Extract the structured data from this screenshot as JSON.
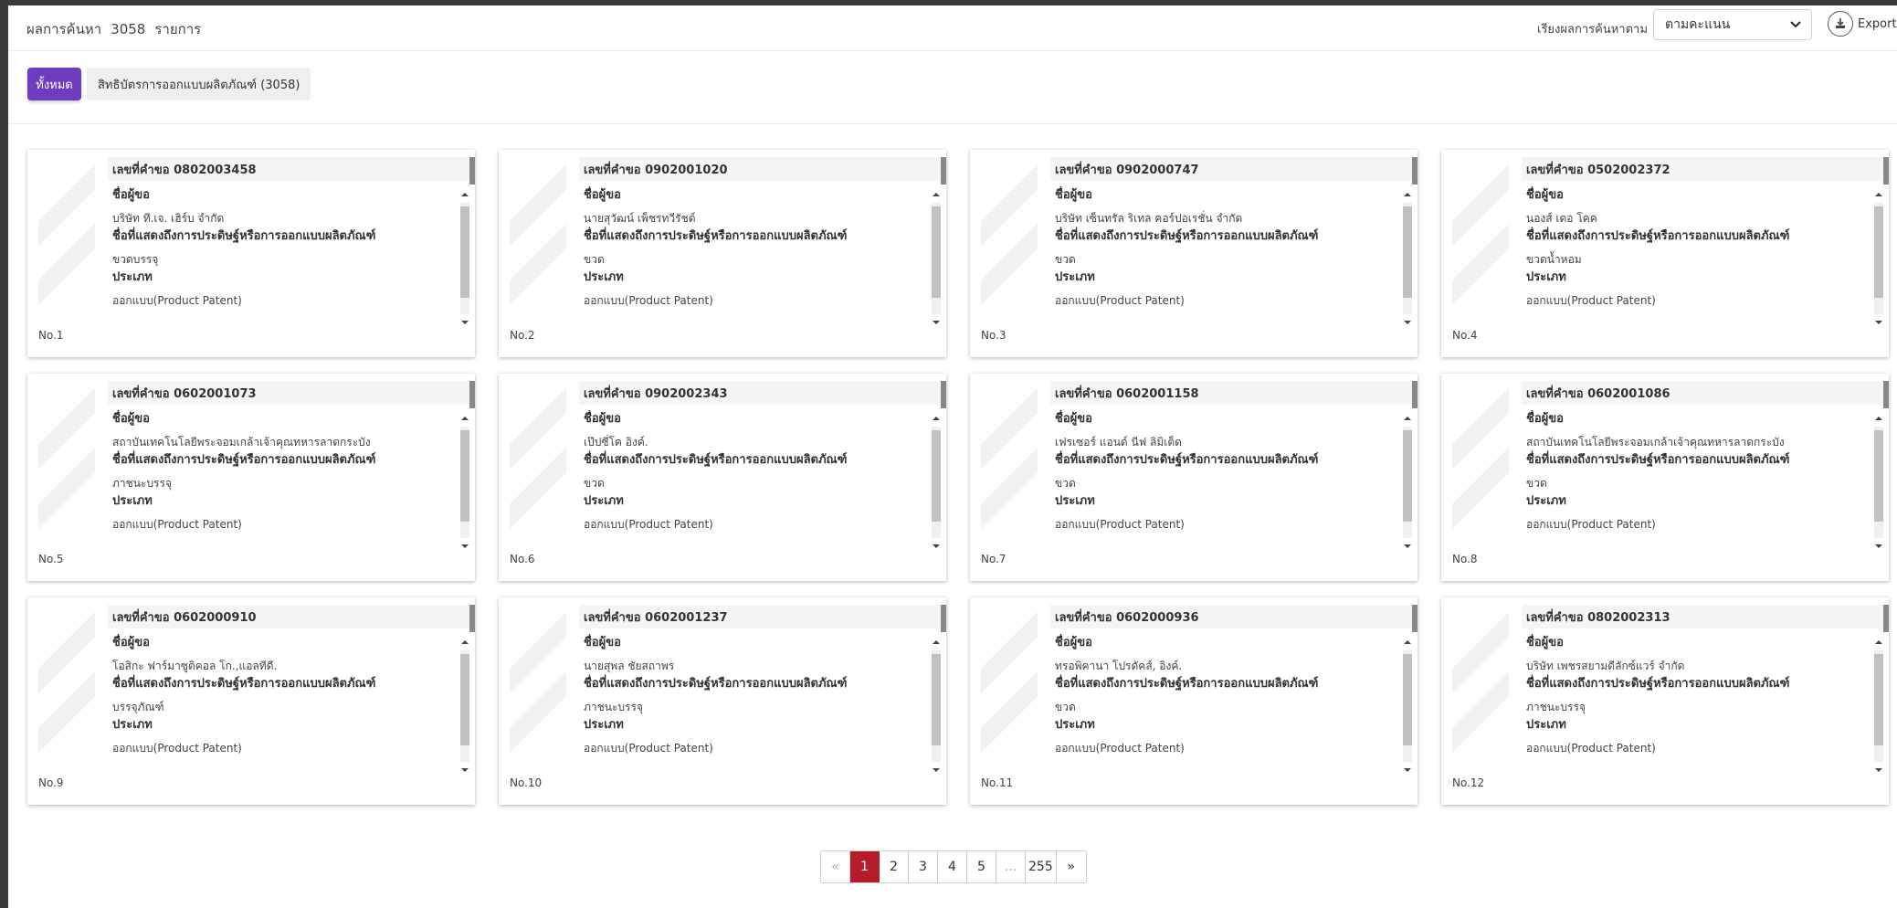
{
  "header": {
    "result_prefix": "ผลการค้นหา",
    "result_count": "3058",
    "result_suffix": "รายการ",
    "sort_label": "เรียงผลการค้นหาตาม",
    "sort_value": "ตามคะแนน",
    "export_label": "Export"
  },
  "filters": {
    "all_label": "ทั้งหมด",
    "category_label": "สิทธิบัตรการออกแบบผลิตภัณฑ์ (3058)"
  },
  "labels": {
    "applicant": "ชื่อผู้ขอ",
    "title": "ชื่อที่แสดงถึงการประดิษฐ์หรือการออกแบบผลิตภัณฑ์",
    "type": "ประเภท"
  },
  "cards": [
    {
      "app_no": "เลขที่คำขอ 0802003458",
      "applicant": "บริษัท ที.เจ. เฮิร์บ จำกัด",
      "title": "ขวดบรรจุ",
      "type": "ออกแบบ(Product Patent)",
      "no": "No.1"
    },
    {
      "app_no": "เลขที่คำขอ 0902001020",
      "applicant": "นายสุวัฒน์ เพ็ชรทวีรัชต์",
      "title": "ขวด",
      "type": "ออกแบบ(Product Patent)",
      "no": "No.2"
    },
    {
      "app_no": "เลขที่คำขอ 0902000747",
      "applicant": "บริษัท เซ็นทรัล ริเทล คอร์ปอเรชั่น จำกัด",
      "title": "ขวด",
      "type": "ออกแบบ(Product Patent)",
      "no": "No.3"
    },
    {
      "app_no": "เลขที่คำขอ 0502002372",
      "applicant": "นองส์ เดอ โคค",
      "title": "ขวดน้ำหอม",
      "type": "ออกแบบ(Product Patent)",
      "no": "No.4"
    },
    {
      "app_no": "เลขที่คำขอ 0602001073",
      "applicant": "สถาบันเทคโนโลยีพระจอมเกล้าเจ้าคุณทหารลาดกระบัง",
      "title": "ภาชนะบรรจุ",
      "type": "ออกแบบ(Product Patent)",
      "no": "No.5"
    },
    {
      "app_no": "เลขที่คำขอ 0902002343",
      "applicant": "เป๊ปซี่โค อิงค์.",
      "title": "ขวด",
      "type": "ออกแบบ(Product Patent)",
      "no": "No.6"
    },
    {
      "app_no": "เลขที่คำขอ 0602001158",
      "applicant": "เฟรเซอร์ แอนด์ นีฟ ลิมิเต็ด",
      "title": "ขวด",
      "type": "ออกแบบ(Product Patent)",
      "no": "No.7"
    },
    {
      "app_no": "เลขที่คำขอ 0602001086",
      "applicant": "สถาบันเทคโนโลยีพระจอมเกล้าเจ้าคุณทหารลาดกระบัง",
      "title": "ขวด",
      "type": "ออกแบบ(Product Patent)",
      "no": "No.8"
    },
    {
      "app_no": "เลขที่คำขอ 0602000910",
      "applicant": "โอสิกะ ฟาร์มาซูติคอล โก.,แอลทีดี.",
      "title": "บรรจุภัณฑ์",
      "type": "ออกแบบ(Product Patent)",
      "no": "No.9"
    },
    {
      "app_no": "เลขที่คำขอ 0602001237",
      "applicant": "นายสุพล ชัยสถาพร",
      "title": "ภาชนะบรรจุ",
      "type": "ออกแบบ(Product Patent)",
      "no": "No.10"
    },
    {
      "app_no": "เลขที่คำขอ 0602000936",
      "applicant": "ทรอพิคานา โปรดัคส์, อิงค์.",
      "title": "ขวด",
      "type": "ออกแบบ(Product Patent)",
      "no": "No.11"
    },
    {
      "app_no": "เลขที่คำขอ 0802002313",
      "applicant": "บริษัท เพชรสยามดีลักซ์แวร์ จำกัด",
      "title": "ภาชนะบรรจุ",
      "type": "ออกแบบ(Product Patent)",
      "no": "No.12"
    }
  ],
  "pagination": {
    "prev": "«",
    "pages": [
      "1",
      "2",
      "3",
      "4",
      "5"
    ],
    "ellipsis": "...",
    "last": "255",
    "next": "»",
    "current": "1"
  }
}
